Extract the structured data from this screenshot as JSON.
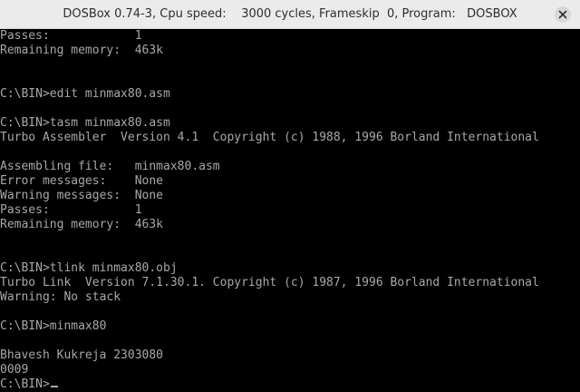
{
  "window": {
    "title": "DOSBox 0.74-3, Cpu speed:    3000 cycles, Frameskip  0, Program:   DOSBOX"
  },
  "icons": {
    "close": "close-icon"
  },
  "terminal": {
    "lines": [
      "Passes:            1",
      "Remaining memory:  463k",
      "",
      "",
      "C:\\BIN>edit minmax80.asm",
      "",
      "C:\\BIN>tasm minmax80.asm",
      "Turbo Assembler  Version 4.1  Copyright (c) 1988, 1996 Borland International",
      "",
      "Assembling file:   minmax80.asm",
      "Error messages:    None",
      "Warning messages:  None",
      "Passes:            1",
      "Remaining memory:  463k",
      "",
      "",
      "C:\\BIN>tlink minmax80.obj",
      "Turbo Link  Version 7.1.30.1. Copyright (c) 1987, 1996 Borland International",
      "Warning: No stack",
      "",
      "C:\\BIN>minmax80",
      "",
      "Bhavesh Kukreja 2303080",
      "0009",
      "C:\\BIN>"
    ],
    "text_color": "#a8a8a8",
    "background": "#000000"
  }
}
